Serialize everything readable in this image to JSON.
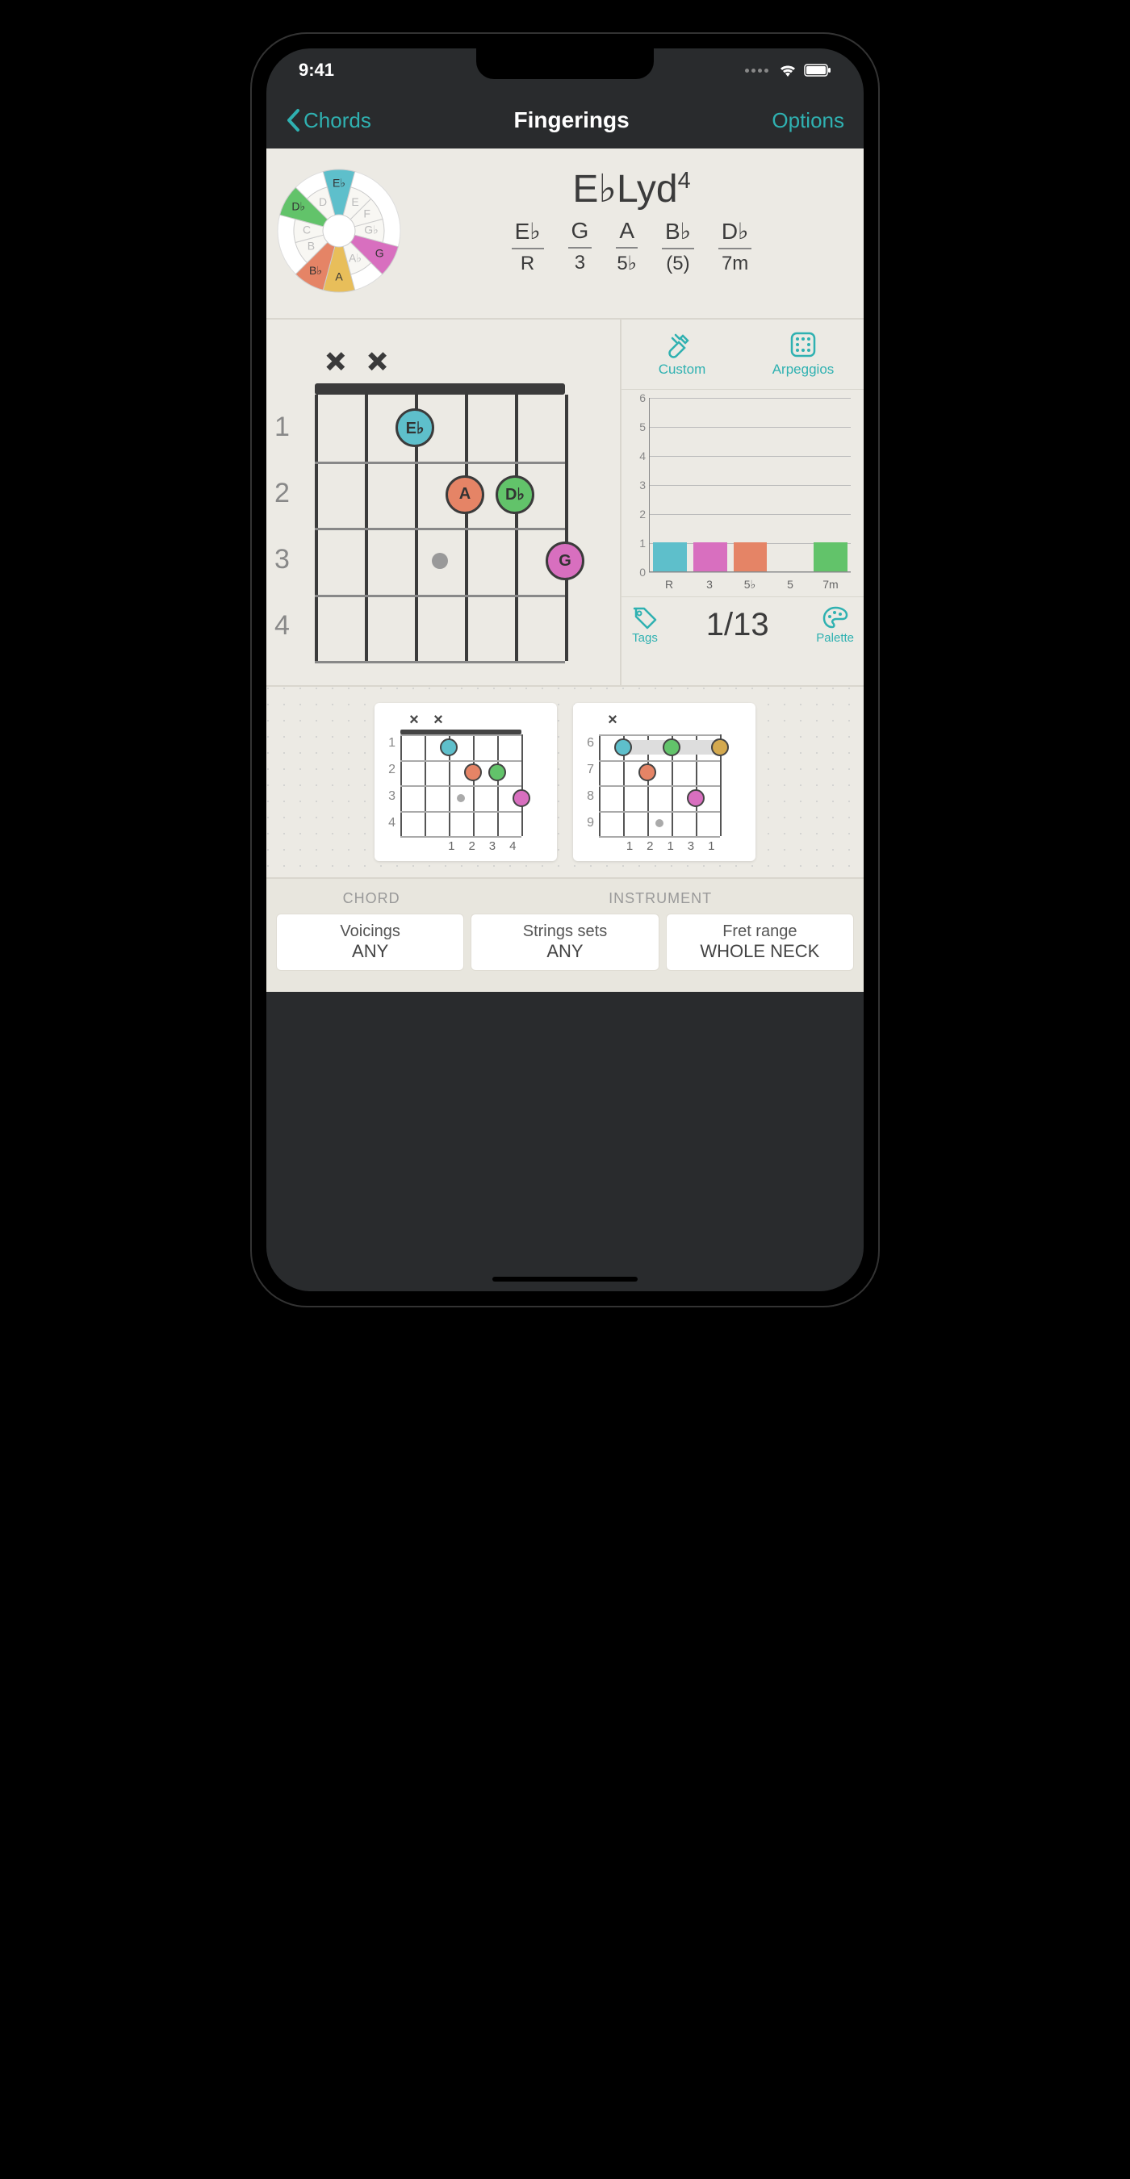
{
  "status": {
    "time": "9:41"
  },
  "nav": {
    "back": "Chords",
    "title": "Fingerings",
    "options": "Options"
  },
  "chord": {
    "name_root": "E♭Lyd",
    "name_sup": "4",
    "notes": [
      {
        "note": "E♭",
        "role": "R"
      },
      {
        "note": "G",
        "role": "3"
      },
      {
        "note": "A",
        "role": "5♭"
      },
      {
        "note": "B♭",
        "role": "(5)"
      },
      {
        "note": "D♭",
        "role": "7m"
      }
    ],
    "wheel_labels": [
      "E♭",
      "E",
      "F",
      "G♭",
      "G",
      "A♭",
      "A",
      "B♭",
      "B",
      "C",
      "D♭",
      "D"
    ]
  },
  "diagram": {
    "fret_labels": [
      "1",
      "2",
      "3",
      "4"
    ],
    "mutes": [
      "×",
      "×",
      "",
      "",
      "",
      ""
    ],
    "dots": [
      {
        "string": 3,
        "fret": 1,
        "label": "E♭",
        "color": "#5ebfcb"
      },
      {
        "string": 4,
        "fret": 2,
        "label": "A",
        "color": "#e58466"
      },
      {
        "string": 5,
        "fret": 2,
        "label": "D♭",
        "color": "#62c36a"
      },
      {
        "string": 6,
        "fret": 3,
        "label": "G",
        "color": "#d86fbf"
      }
    ],
    "marker": {
      "string": 3.5,
      "fret": 3
    }
  },
  "side": {
    "custom": "Custom",
    "arpeggios": "Arpeggios",
    "tags": "Tags",
    "palette": "Palette",
    "counter": "1/13"
  },
  "chart_data": {
    "type": "bar",
    "categories": [
      "R",
      "3",
      "5♭",
      "5",
      "7m"
    ],
    "values": [
      1,
      1,
      1,
      0,
      1
    ],
    "colors": [
      "#5ebfcb",
      "#d86fbf",
      "#e58466",
      "#c9c5bb",
      "#62c36a"
    ],
    "ylim": [
      0,
      6
    ],
    "yticks": [
      0,
      1,
      2,
      3,
      4,
      5,
      6
    ]
  },
  "thumbnails": [
    {
      "mutes": [
        "×",
        "×",
        "",
        "",
        "",
        ""
      ],
      "fret_labels": [
        "1",
        "2",
        "3",
        "4"
      ],
      "fingers": [
        "",
        "",
        "1",
        "2",
        "3",
        "4"
      ],
      "dots": [
        {
          "s": 3,
          "f": 1,
          "c": "#5ebfcb"
        },
        {
          "s": 4,
          "f": 2,
          "c": "#e58466"
        },
        {
          "s": 5,
          "f": 2,
          "c": "#62c36a"
        },
        {
          "s": 6,
          "f": 3,
          "c": "#d86fbf"
        }
      ],
      "markers": [
        {
          "s": 3.5,
          "f": 3
        }
      ]
    },
    {
      "mutes": [
        "×",
        "",
        "",
        "",
        "",
        ""
      ],
      "fret_labels": [
        "6",
        "7",
        "8",
        "9"
      ],
      "fingers": [
        "",
        "1",
        "2",
        "1",
        "3",
        "1"
      ],
      "barre": {
        "from": 2,
        "to": 6,
        "f": 1
      },
      "dots": [
        {
          "s": 2,
          "f": 1,
          "c": "#5ebfcb"
        },
        {
          "s": 4,
          "f": 1,
          "c": "#62c36a"
        },
        {
          "s": 6,
          "f": 1,
          "c": "#d4a94e"
        },
        {
          "s": 3,
          "f": 2,
          "c": "#e58466"
        },
        {
          "s": 5,
          "f": 3,
          "c": "#d86fbf"
        }
      ],
      "markers": [
        {
          "s": 3.5,
          "f": 4
        }
      ]
    }
  ],
  "filters": {
    "chord_header": "CHORD",
    "instrument_header": "INSTRUMENT",
    "buttons": [
      {
        "title": "Voicings",
        "value": "ANY"
      },
      {
        "title": "Strings sets",
        "value": "ANY"
      },
      {
        "title": "Fret range",
        "value": "WHOLE NECK"
      }
    ]
  }
}
